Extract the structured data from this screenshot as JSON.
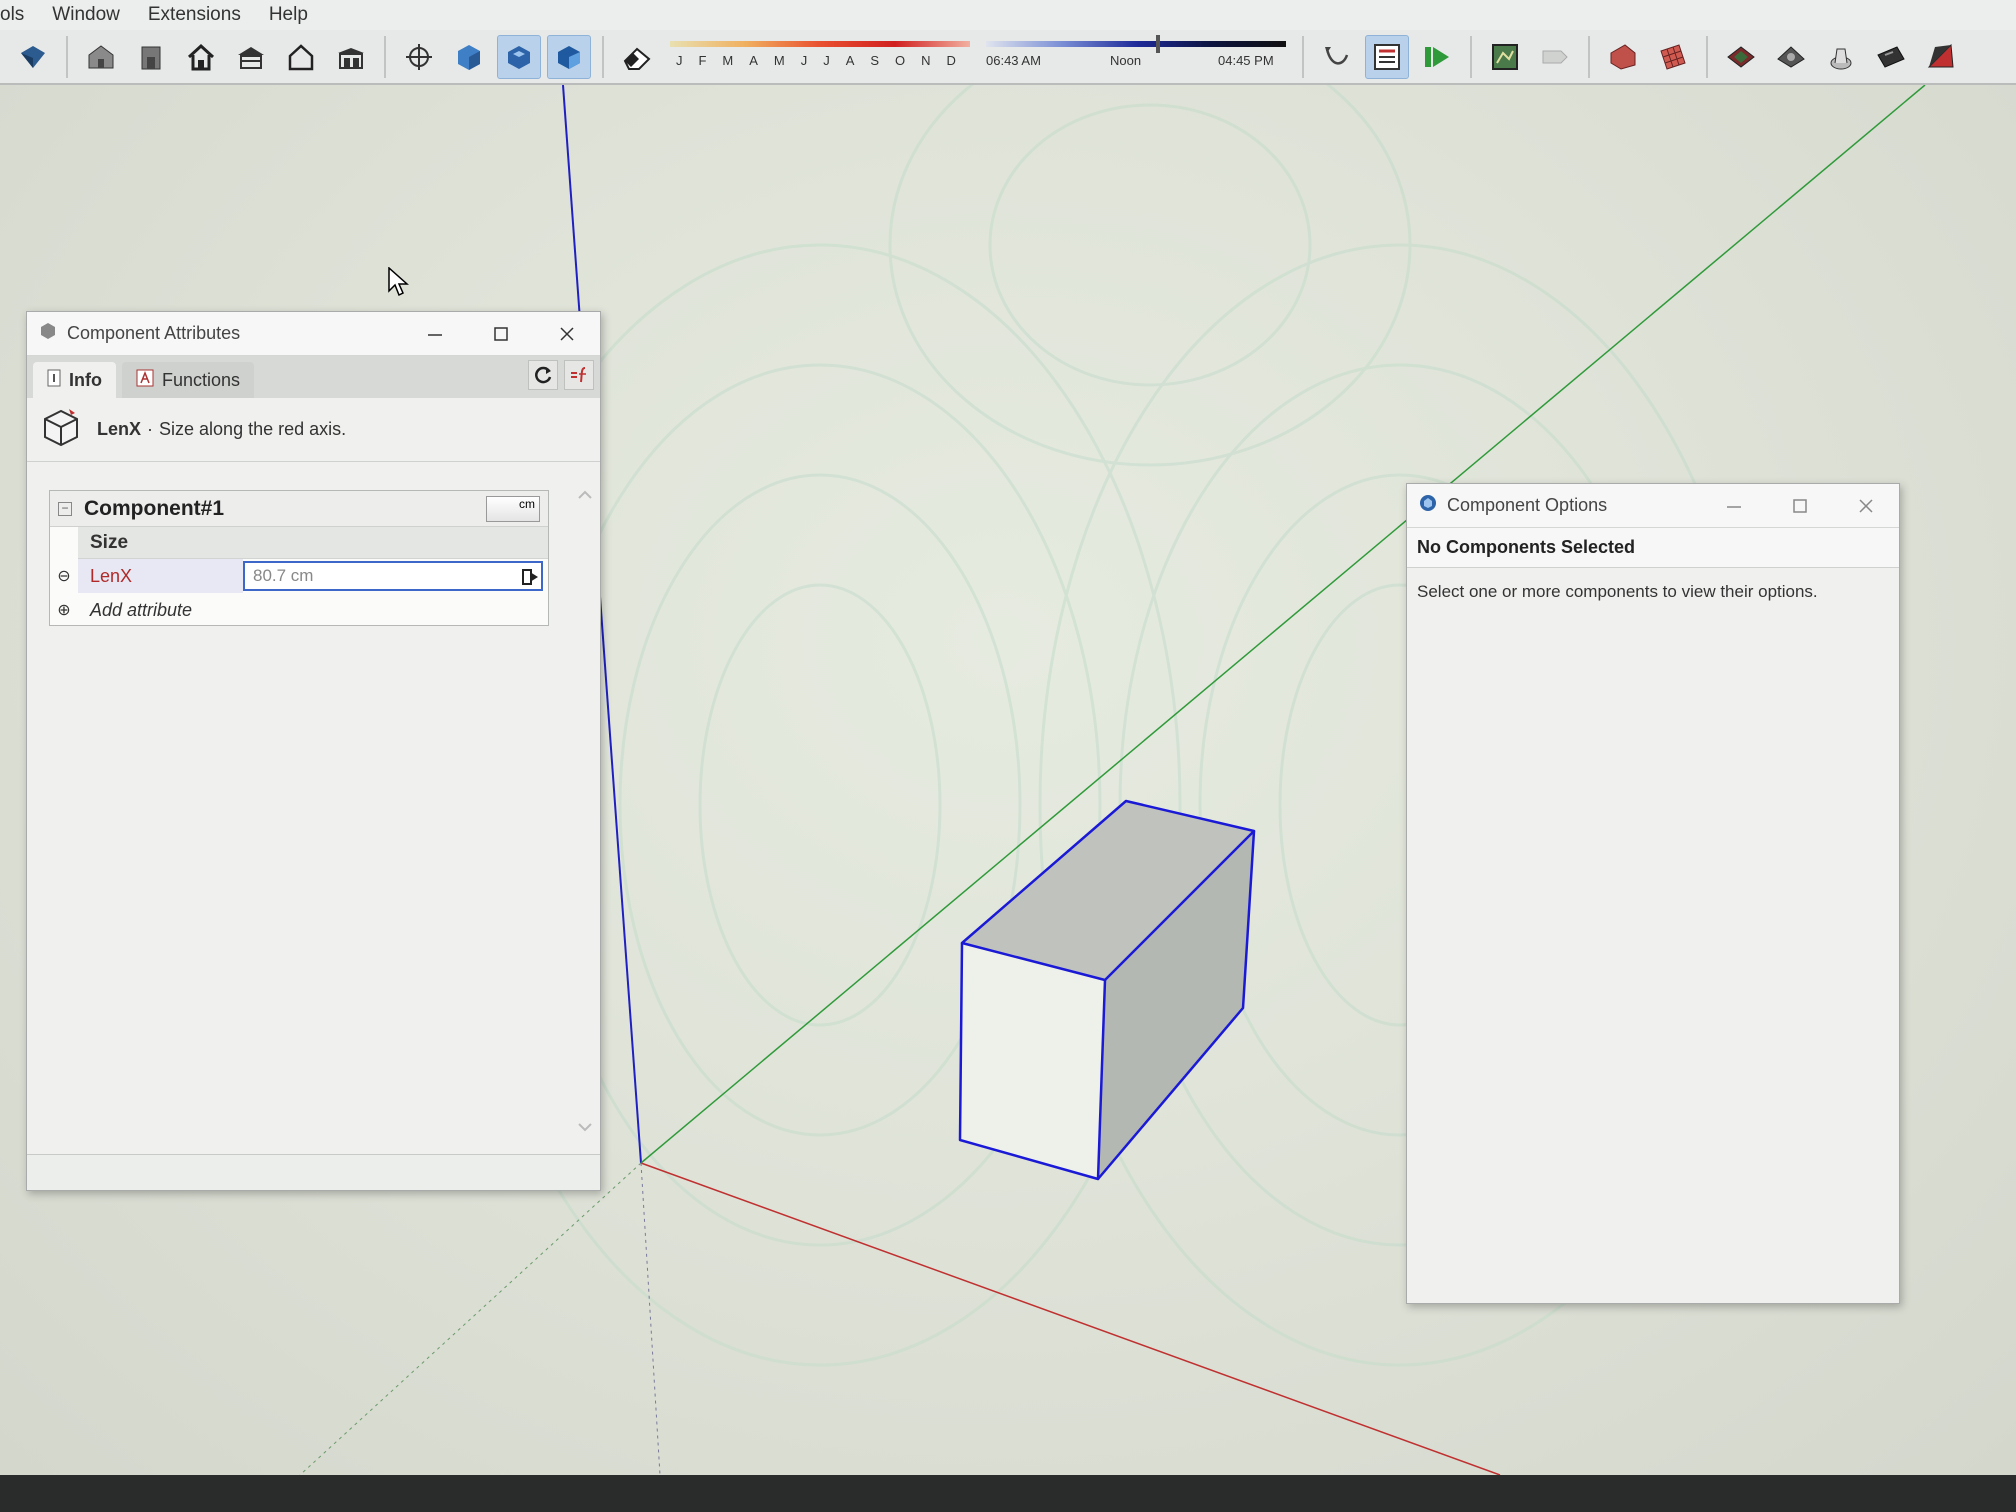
{
  "menubar": {
    "items": [
      "ols",
      "Window",
      "Extensions",
      "Help"
    ]
  },
  "toolbar": {
    "shadow_months": [
      "J",
      "F",
      "M",
      "A",
      "M",
      "J",
      "J",
      "A",
      "S",
      "O",
      "N",
      "D"
    ],
    "time_start": "06:43 AM",
    "time_mid": "Noon",
    "time_end": "04:45 PM",
    "buttons": [
      "styles-icon",
      "house-iso-icon",
      "house-front-icon",
      "house-home-icon",
      "house-roof-icon",
      "house-outline-icon",
      "house-side-icon",
      "orbit-icon",
      "section-blue-icon",
      "component-active-icon",
      "component-blue-icon",
      "eraser-icon",
      "undo-curve-icon",
      "report-icon",
      "play-icon",
      "map-icon",
      "tag-icon",
      "layer-red-icon",
      "grid-red-icon",
      "sandbox-1-icon",
      "sandbox-2-icon",
      "sandbox-3-icon",
      "sandbox-4-icon",
      "sandbox-5-icon"
    ]
  },
  "attr_window": {
    "title": "Component Attributes",
    "tabs": [
      {
        "label": "Info",
        "icon": "info-icon"
      },
      {
        "label": "Functions",
        "icon": "function-icon"
      }
    ],
    "info_attr": "LenX",
    "info_sep": "·",
    "info_desc": "Size along the red axis.",
    "component_name": "Component#1",
    "units": "cm",
    "section": "Size",
    "rows": [
      {
        "name": "LenX",
        "value": "80.7 cm"
      }
    ],
    "add_label": "Add attribute"
  },
  "options_window": {
    "title": "Component Options",
    "heading": "No Components Selected",
    "body": "Select one or more components to view their options."
  },
  "colors": {
    "accent": "#3d67c9",
    "selection_edge": "#1a1ad6",
    "axis_red": "#c03030",
    "axis_green": "#2f9a3a",
    "axis_blue": "#2020c0"
  }
}
